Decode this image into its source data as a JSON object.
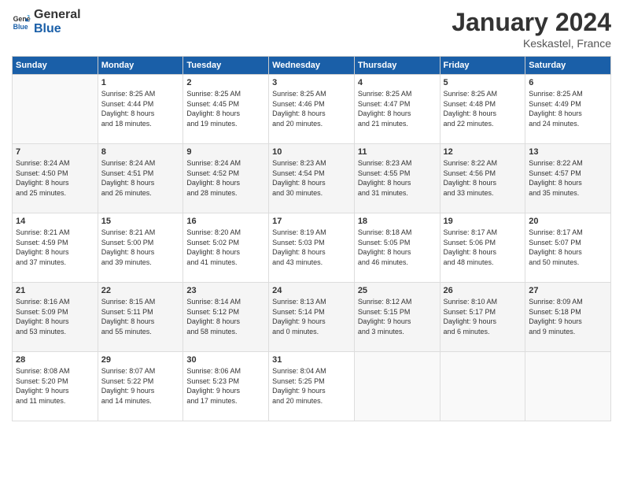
{
  "header": {
    "logo_general": "General",
    "logo_blue": "Blue",
    "month_title": "January 2024",
    "location": "Keskastel, France"
  },
  "columns": [
    "Sunday",
    "Monday",
    "Tuesday",
    "Wednesday",
    "Thursday",
    "Friday",
    "Saturday"
  ],
  "weeks": [
    [
      {
        "day": "",
        "info": ""
      },
      {
        "day": "1",
        "info": "Sunrise: 8:25 AM\nSunset: 4:44 PM\nDaylight: 8 hours\nand 18 minutes."
      },
      {
        "day": "2",
        "info": "Sunrise: 8:25 AM\nSunset: 4:45 PM\nDaylight: 8 hours\nand 19 minutes."
      },
      {
        "day": "3",
        "info": "Sunrise: 8:25 AM\nSunset: 4:46 PM\nDaylight: 8 hours\nand 20 minutes."
      },
      {
        "day": "4",
        "info": "Sunrise: 8:25 AM\nSunset: 4:47 PM\nDaylight: 8 hours\nand 21 minutes."
      },
      {
        "day": "5",
        "info": "Sunrise: 8:25 AM\nSunset: 4:48 PM\nDaylight: 8 hours\nand 22 minutes."
      },
      {
        "day": "6",
        "info": "Sunrise: 8:25 AM\nSunset: 4:49 PM\nDaylight: 8 hours\nand 24 minutes."
      }
    ],
    [
      {
        "day": "7",
        "info": "Sunrise: 8:24 AM\nSunset: 4:50 PM\nDaylight: 8 hours\nand 25 minutes."
      },
      {
        "day": "8",
        "info": "Sunrise: 8:24 AM\nSunset: 4:51 PM\nDaylight: 8 hours\nand 26 minutes."
      },
      {
        "day": "9",
        "info": "Sunrise: 8:24 AM\nSunset: 4:52 PM\nDaylight: 8 hours\nand 28 minutes."
      },
      {
        "day": "10",
        "info": "Sunrise: 8:23 AM\nSunset: 4:54 PM\nDaylight: 8 hours\nand 30 minutes."
      },
      {
        "day": "11",
        "info": "Sunrise: 8:23 AM\nSunset: 4:55 PM\nDaylight: 8 hours\nand 31 minutes."
      },
      {
        "day": "12",
        "info": "Sunrise: 8:22 AM\nSunset: 4:56 PM\nDaylight: 8 hours\nand 33 minutes."
      },
      {
        "day": "13",
        "info": "Sunrise: 8:22 AM\nSunset: 4:57 PM\nDaylight: 8 hours\nand 35 minutes."
      }
    ],
    [
      {
        "day": "14",
        "info": "Sunrise: 8:21 AM\nSunset: 4:59 PM\nDaylight: 8 hours\nand 37 minutes."
      },
      {
        "day": "15",
        "info": "Sunrise: 8:21 AM\nSunset: 5:00 PM\nDaylight: 8 hours\nand 39 minutes."
      },
      {
        "day": "16",
        "info": "Sunrise: 8:20 AM\nSunset: 5:02 PM\nDaylight: 8 hours\nand 41 minutes."
      },
      {
        "day": "17",
        "info": "Sunrise: 8:19 AM\nSunset: 5:03 PM\nDaylight: 8 hours\nand 43 minutes."
      },
      {
        "day": "18",
        "info": "Sunrise: 8:18 AM\nSunset: 5:05 PM\nDaylight: 8 hours\nand 46 minutes."
      },
      {
        "day": "19",
        "info": "Sunrise: 8:17 AM\nSunset: 5:06 PM\nDaylight: 8 hours\nand 48 minutes."
      },
      {
        "day": "20",
        "info": "Sunrise: 8:17 AM\nSunset: 5:07 PM\nDaylight: 8 hours\nand 50 minutes."
      }
    ],
    [
      {
        "day": "21",
        "info": "Sunrise: 8:16 AM\nSunset: 5:09 PM\nDaylight: 8 hours\nand 53 minutes."
      },
      {
        "day": "22",
        "info": "Sunrise: 8:15 AM\nSunset: 5:11 PM\nDaylight: 8 hours\nand 55 minutes."
      },
      {
        "day": "23",
        "info": "Sunrise: 8:14 AM\nSunset: 5:12 PM\nDaylight: 8 hours\nand 58 minutes."
      },
      {
        "day": "24",
        "info": "Sunrise: 8:13 AM\nSunset: 5:14 PM\nDaylight: 9 hours\nand 0 minutes."
      },
      {
        "day": "25",
        "info": "Sunrise: 8:12 AM\nSunset: 5:15 PM\nDaylight: 9 hours\nand 3 minutes."
      },
      {
        "day": "26",
        "info": "Sunrise: 8:10 AM\nSunset: 5:17 PM\nDaylight: 9 hours\nand 6 minutes."
      },
      {
        "day": "27",
        "info": "Sunrise: 8:09 AM\nSunset: 5:18 PM\nDaylight: 9 hours\nand 9 minutes."
      }
    ],
    [
      {
        "day": "28",
        "info": "Sunrise: 8:08 AM\nSunset: 5:20 PM\nDaylight: 9 hours\nand 11 minutes."
      },
      {
        "day": "29",
        "info": "Sunrise: 8:07 AM\nSunset: 5:22 PM\nDaylight: 9 hours\nand 14 minutes."
      },
      {
        "day": "30",
        "info": "Sunrise: 8:06 AM\nSunset: 5:23 PM\nDaylight: 9 hours\nand 17 minutes."
      },
      {
        "day": "31",
        "info": "Sunrise: 8:04 AM\nSunset: 5:25 PM\nDaylight: 9 hours\nand 20 minutes."
      },
      {
        "day": "",
        "info": ""
      },
      {
        "day": "",
        "info": ""
      },
      {
        "day": "",
        "info": ""
      }
    ]
  ]
}
